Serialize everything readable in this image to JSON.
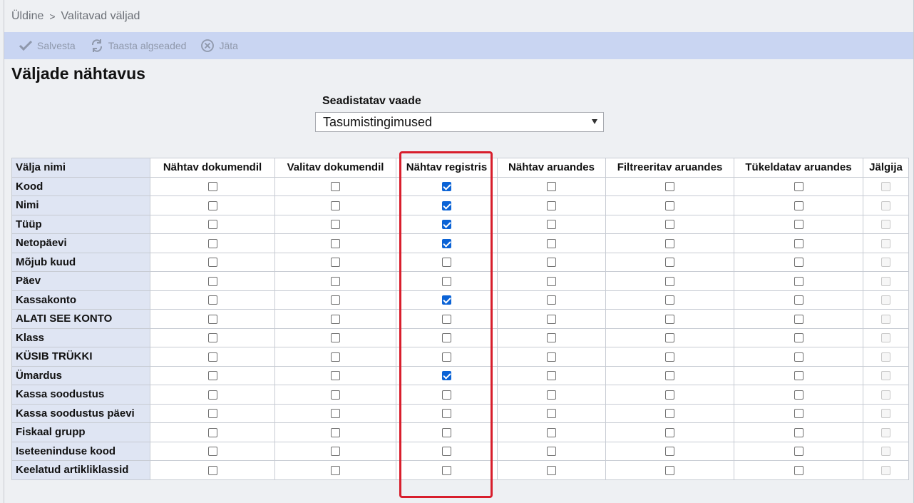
{
  "breadcrumb": {
    "items": [
      "Üldine",
      "Valitavad väljad"
    ],
    "separator": ">"
  },
  "toolbar": {
    "save_label": "Salvesta",
    "reset_label": "Taasta algseaded",
    "cancel_label": "Jäta"
  },
  "page_title": "Väljade nähtavus",
  "view_select": {
    "label": "Seadistatav vaade",
    "value": "Tasumistingimused"
  },
  "table": {
    "columns": [
      "Välja nimi",
      "Nähtav dokumendil",
      "Valitav dokumendil",
      "Nähtav registris",
      "Nähtav aruandes",
      "Filtreeritav aruandes",
      "Tükeldatav aruandes",
      "Jälgija"
    ],
    "rows": [
      {
        "name": "Kood",
        "checks": [
          false,
          false,
          true,
          false,
          false,
          false,
          false
        ]
      },
      {
        "name": "Nimi",
        "checks": [
          false,
          false,
          true,
          false,
          false,
          false,
          false
        ]
      },
      {
        "name": "Tüüp",
        "checks": [
          false,
          false,
          true,
          false,
          false,
          false,
          false
        ]
      },
      {
        "name": "Netopäevi",
        "checks": [
          false,
          false,
          true,
          false,
          false,
          false,
          false
        ]
      },
      {
        "name": "Mõjub kuud",
        "checks": [
          false,
          false,
          false,
          false,
          false,
          false,
          false
        ]
      },
      {
        "name": "Päev",
        "checks": [
          false,
          false,
          false,
          false,
          false,
          false,
          false
        ]
      },
      {
        "name": "Kassakonto",
        "checks": [
          false,
          false,
          true,
          false,
          false,
          false,
          false
        ]
      },
      {
        "name": "ALATI SEE KONTO",
        "checks": [
          false,
          false,
          false,
          false,
          false,
          false,
          false
        ]
      },
      {
        "name": "Klass",
        "checks": [
          false,
          false,
          false,
          false,
          false,
          false,
          false
        ]
      },
      {
        "name": "KÜSIB TRÜKKI",
        "checks": [
          false,
          false,
          false,
          false,
          false,
          false,
          false
        ]
      },
      {
        "name": "Ümardus",
        "checks": [
          false,
          false,
          true,
          false,
          false,
          false,
          false
        ]
      },
      {
        "name": "Kassa soodustus",
        "checks": [
          false,
          false,
          false,
          false,
          false,
          false,
          false
        ]
      },
      {
        "name": "Kassa soodustus päevi",
        "checks": [
          false,
          false,
          false,
          false,
          false,
          false,
          false
        ]
      },
      {
        "name": "Fiskaal grupp",
        "checks": [
          false,
          false,
          false,
          false,
          false,
          false,
          false
        ]
      },
      {
        "name": "Iseteeninduse kood",
        "checks": [
          false,
          false,
          false,
          false,
          false,
          false,
          false
        ]
      },
      {
        "name": "Keelatud artikliklassid",
        "checks": [
          false,
          false,
          false,
          false,
          false,
          false,
          false
        ]
      }
    ]
  },
  "colors": {
    "toolbar_bg": "#c9d5f2",
    "checkbox_checked": "#0b63d6",
    "highlight": "#d81e2c",
    "name_column_bg": "#dfe5f3"
  },
  "icons": {
    "save": "checkmark-icon",
    "reset": "refresh-icon",
    "cancel": "circle-x-icon"
  }
}
